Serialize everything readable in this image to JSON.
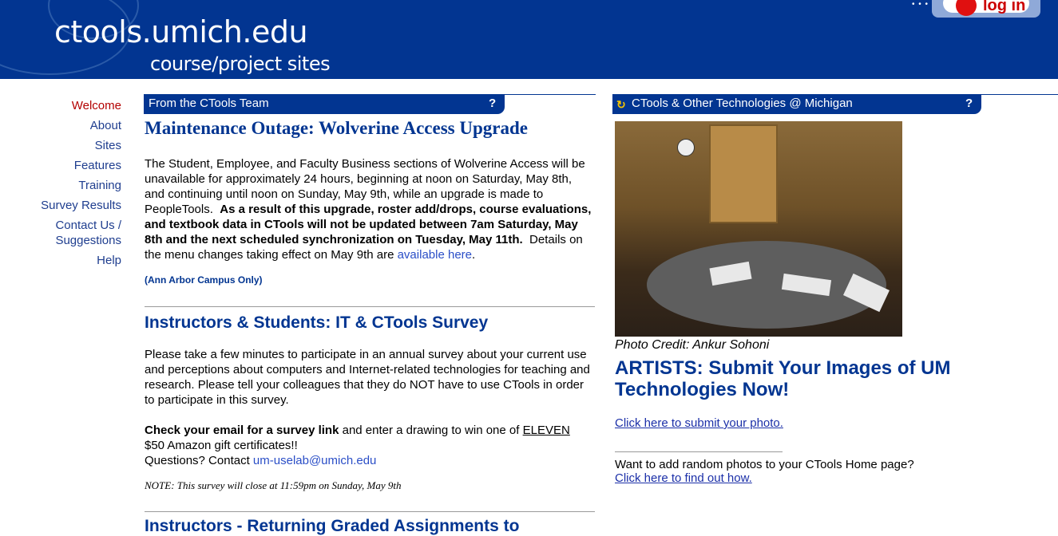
{
  "header": {
    "title": "ctools.umich.edu",
    "subtitle": "course/project sites",
    "login_label": "log in",
    "bg_color": "#023591"
  },
  "nav": {
    "items": [
      {
        "label": "Welcome",
        "active": true
      },
      {
        "label": "About"
      },
      {
        "label": "Sites"
      },
      {
        "label": "Features"
      },
      {
        "label": "Training"
      },
      {
        "label": "Survey Results"
      },
      {
        "label": "Contact Us / Suggestions"
      },
      {
        "label": "Help"
      }
    ]
  },
  "center": {
    "portlet_title": "From the CTools Team",
    "help_label": "?",
    "article1": {
      "title": "Maintenance Outage: Wolverine Access Upgrade",
      "text1": "The Student, Employee, and Faculty Business sections of Wolverine Access will be unavailable for approximately 24 hours, beginning at noon on Saturday, May 8th, and continuing until noon on Sunday, May 9th, while an upgrade is made to PeopleTools.",
      "bold": "As a result of this upgrade, roster add/drops, course evaluations, and textbook data in CTools will not be updated between 7am Saturday, May 8th and the next scheduled synchronization on Tuesday, May 11th.",
      "text2": "Details on the menu changes taking effect on May 9th are",
      "link": "available here",
      "text3": ".",
      "campus": "(Ann Arbor Campus Only)"
    },
    "article2": {
      "title": "Instructors & Students: IT & CTools Survey",
      "text1": "Please take a few minutes to participate in an annual survey about your current use and perceptions about computers and Internet-related technologies for teaching and research. Please tell your colleagues that they do NOT have to use CTools in order to participate in this survey.",
      "bold": "Check your email for a survey link",
      "text2": "and enter a drawing to win one of",
      "underline": "ELEVEN",
      "text3": "$50 Amazon gift certificates!!",
      "questions": "Questions? Contact",
      "email": "um-uselab@umich.edu",
      "note": "NOTE: This survey will close at 11:59pm on Sunday, May 9th"
    },
    "article3": {
      "title": "Instructors - Returning Graded Assignments to"
    }
  },
  "right": {
    "portlet_title": "CTools & Other Technologies @ Michigan",
    "help_label": "?",
    "credit": "Photo Credit: Ankur Sohoni",
    "heading": "ARTISTS: Submit Your Images of UM Technologies Now!",
    "submit_link": "Click here to submit your photo.",
    "question": "Want to add random photos to your CTools Home page?",
    "find_link": "Click here to find out how."
  }
}
